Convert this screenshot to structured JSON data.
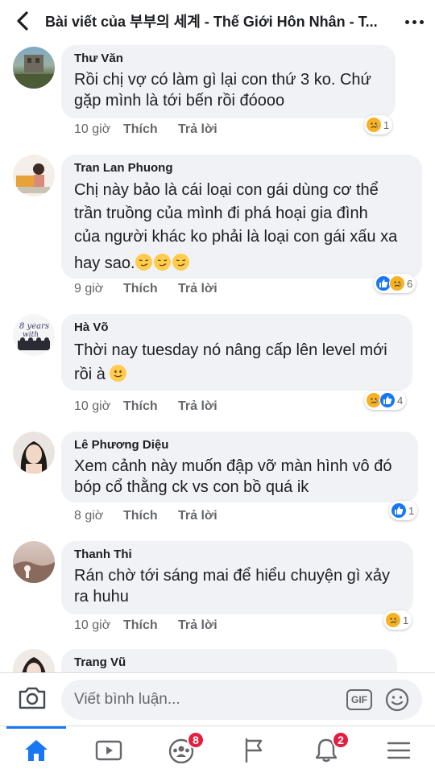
{
  "header": {
    "title": "Bài viết của 부부의 세계 - Thế Giới Hôn Nhân - T..."
  },
  "comments": [
    {
      "author": "Thư Văn",
      "lines": [
        "Rồi chị vợ có làm gì lại con thứ 3 ko. Chứ",
        "gặp mình là tới bến rồi đóooo"
      ],
      "time": "10 giờ",
      "like_label": "Thích",
      "reply_label": "Trả lời",
      "reactions": [
        "sad"
      ],
      "reaction_count": "1"
    },
    {
      "author": "Tran Lan Phuong",
      "lines": [
        "Chị này bảo là cái loại con gái dùng cơ thể",
        "trần truồng của mình đi phá hoại gia đình",
        "của người khác ko phải là loại con gái xấu xa",
        "hay sao."
      ],
      "time": "9 giờ",
      "like_label": "Thích",
      "reply_label": "Trả lời",
      "reactions": [
        "like",
        "sad"
      ],
      "reaction_count": "6"
    },
    {
      "author": "Hà Võ",
      "lines": [
        "Thời nay tuesday nó nâng cấp lên level mới",
        "rồi à"
      ],
      "time": "10 giờ",
      "like_label": "Thích",
      "reply_label": "Trả lời",
      "reactions": [
        "sad",
        "like"
      ],
      "reaction_count": "4",
      "avatar_text": "# 8 years with"
    },
    {
      "author": "Lê Phương Diệu",
      "lines": [
        "Xem cảnh này muốn đập vỡ màn hình vô đó",
        "bóp cổ thằng ck vs con bồ quá ik"
      ],
      "time": "8 giờ",
      "like_label": "Thích",
      "reply_label": "Trả lời",
      "reactions": [
        "like"
      ],
      "reaction_count": "1"
    },
    {
      "author": "Thanh Thi",
      "lines": [
        "Rán chờ tới sáng mai để hiểu chuyện gì xảy",
        "ra huhu"
      ],
      "time": "10 giờ",
      "like_label": "Thích",
      "reply_label": "Trả lời",
      "reactions": [
        "sad"
      ],
      "reaction_count": "1"
    },
    {
      "author": "Trang Vũ"
    }
  ],
  "composer": {
    "placeholder": "Viết bình luận...",
    "gif_label": "GIF"
  },
  "tabbar": {
    "groups_badge": "8",
    "notifications_badge": "2"
  },
  "colors": {
    "accent": "#1877f2",
    "bubble": "#f0f2f5",
    "badge": "#e41e3f",
    "secondary_text": "#65676b"
  }
}
